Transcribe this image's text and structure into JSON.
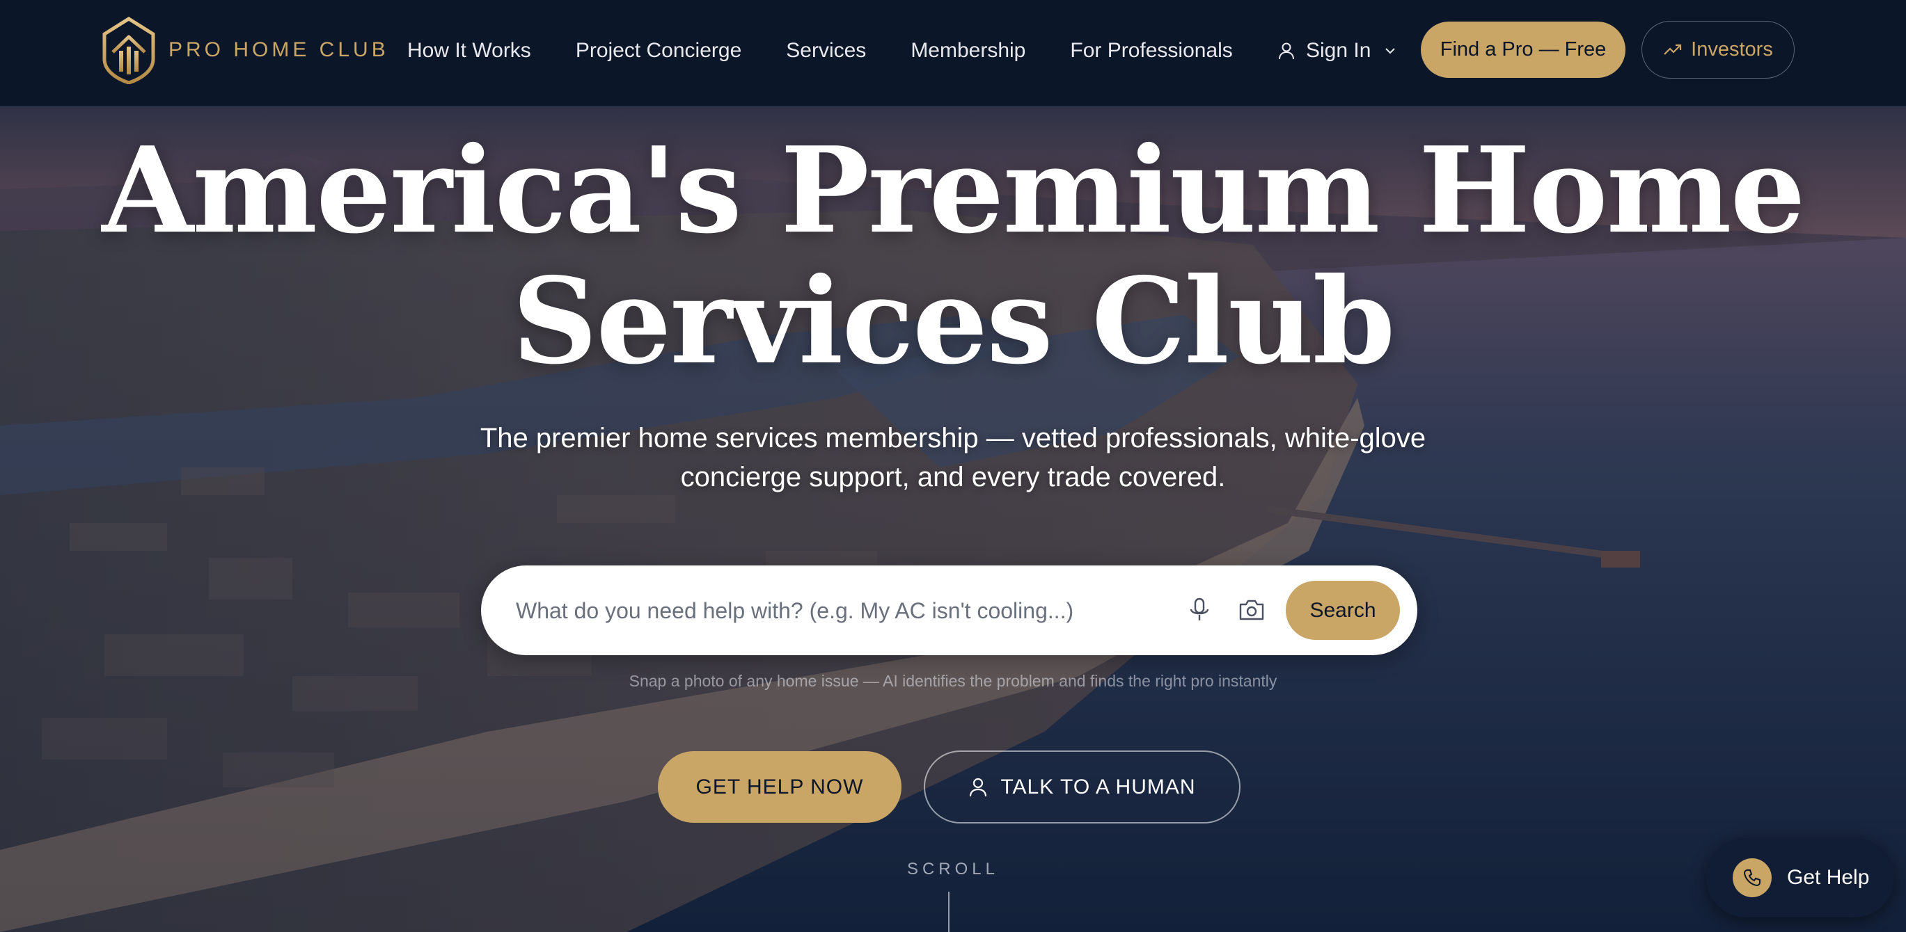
{
  "brand": {
    "name": "PRO HOME CLUB",
    "accent_color": "#c9a566",
    "nav_bg": "#0b1629"
  },
  "nav": {
    "links": [
      "How It Works",
      "Project Concierge",
      "Services",
      "Membership",
      "For Professionals"
    ],
    "signin_label": "Sign In",
    "find_pro_label": "Find a Pro — Free",
    "investors_label": "Investors"
  },
  "hero": {
    "headline_line1": "America's Premium Home",
    "headline_line2": "Services Club",
    "subtitle_line1": "The premier home services membership — vetted professionals, white-glove",
    "subtitle_line2": "concierge support, and every trade covered.",
    "search": {
      "placeholder": "What do you need help with? (e.g. My AC isn't cooling...)",
      "value": "",
      "button_label": "Search",
      "mic_icon": "microphone-icon",
      "camera_icon": "camera-icon"
    },
    "hint": "Snap a photo of any home issue — AI identifies the problem and finds the right pro instantly",
    "cta_primary": "GET HELP NOW",
    "cta_secondary": "TALK TO A HUMAN",
    "scroll_label": "SCROLL"
  },
  "floating": {
    "get_help_label": "Get Help",
    "icon": "phone-icon"
  }
}
